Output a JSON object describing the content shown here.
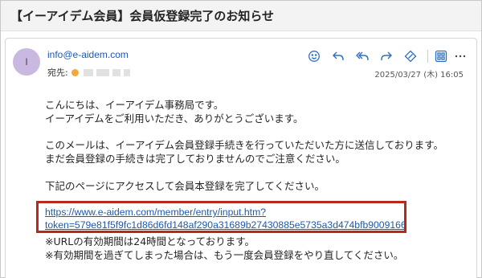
{
  "subject": "【イーアイデム会員】会員仮登録完了のお知らせ",
  "avatar_initial": "I",
  "sender": "info@e-aidem.com",
  "to_label": "宛先:",
  "timestamp": "2025/03/27 (木) 16:05",
  "toolbar_icons": [
    "emoji-icon",
    "reply-icon",
    "reply-all-icon",
    "forward-icon",
    "tag-icon",
    "apps-icon",
    "more-icon"
  ],
  "body": {
    "greeting": "こんにちは、イーアイデム事務局です。",
    "thanks": "イーアイデムをご利用いただき、ありがとうございます。",
    "para2_line1": "このメールは、イーアイデム会員登録手続きを行っていただいた方に送信しております。",
    "para2_line2": "まだ会員登録の手続きは完了しておりませんのでご注意ください。",
    "instruction": "下記のページにアクセスして会員本登録を完了してください。",
    "link_line1": "https://www.e-aidem.com/member/entry/input.htm?",
    "link_line2": "token=579e81f5f9fc1d86d6fd148af290a31689b27430885e5735a3d474bfb9009166",
    "note1": "※URLの有効期間は24時間となっております。",
    "note2": "※有効期間を過ぎてしまった場合は、もう一度会員登録をやり直してください。"
  },
  "colors": {
    "link": "#1d5aab",
    "highlight_border": "#b8281b",
    "avatar_bg": "#c9b8df",
    "toolbar_icon": "#2f6fc1"
  }
}
